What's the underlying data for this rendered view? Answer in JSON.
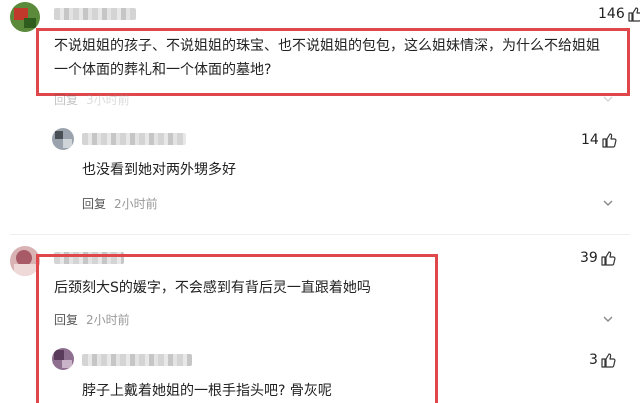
{
  "colors": {
    "highlight": "#e0474a",
    "meta_text": "#999999",
    "reply_text": "#555555",
    "body_text": "#222222"
  },
  "comments": [
    {
      "likes": "146",
      "text_line1": "不说姐姐的孩子、不说姐姐的珠宝、也不说姐姐的包包，这么姐妹情深，为什么不给姐姐",
      "text_line2": "一个体面的葬礼和一个体面的墓地?",
      "reply_label": "回复",
      "time": "3小时前"
    },
    {
      "likes": "14",
      "text": "也没看到她对两外甥多好",
      "reply_label": "回复",
      "time": "2小时前"
    },
    {
      "likes": "39",
      "text": "后颈刻大S的媛字，不会感到有背后灵一直跟着她吗",
      "reply_label": "回复",
      "time": "2小时前"
    },
    {
      "likes": "3",
      "text": "脖子上戴着她姐的一根手指头吧? 骨灰呢"
    }
  ],
  "icons": {
    "like": "thumbs-up-icon",
    "expand": "chevron-down-icon"
  }
}
